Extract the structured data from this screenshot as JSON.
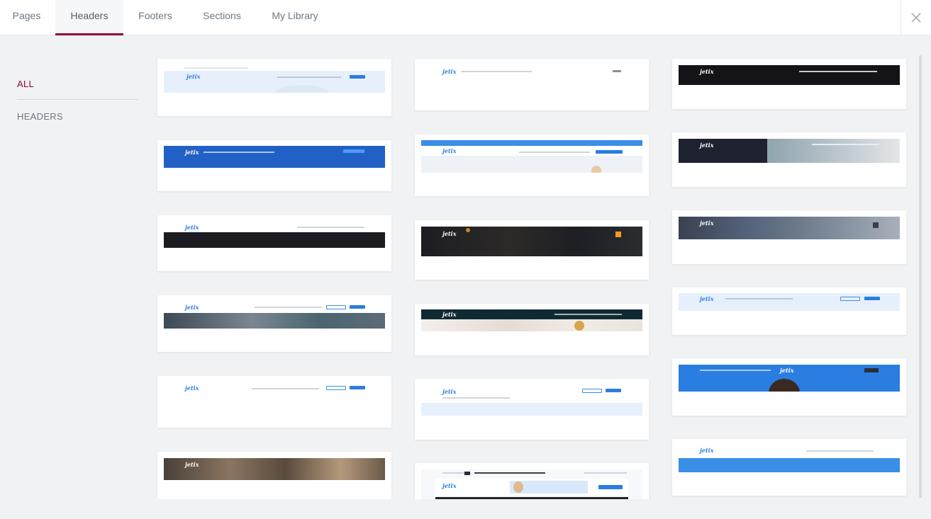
{
  "tabs": [
    {
      "label": "Pages"
    },
    {
      "label": "Headers"
    },
    {
      "label": "Footers"
    },
    {
      "label": "Sections"
    },
    {
      "label": "My Library"
    }
  ],
  "active_tab": "Headers",
  "filters": [
    {
      "label": "ALL"
    },
    {
      "label": "HEADERS"
    }
  ],
  "active_filter": "ALL",
  "template_logo": "jetix",
  "colors": {
    "accent": "#93003c",
    "blue": "#2a7de1",
    "dark": "#1b1b22",
    "light_blue": "#e6f0fd"
  }
}
